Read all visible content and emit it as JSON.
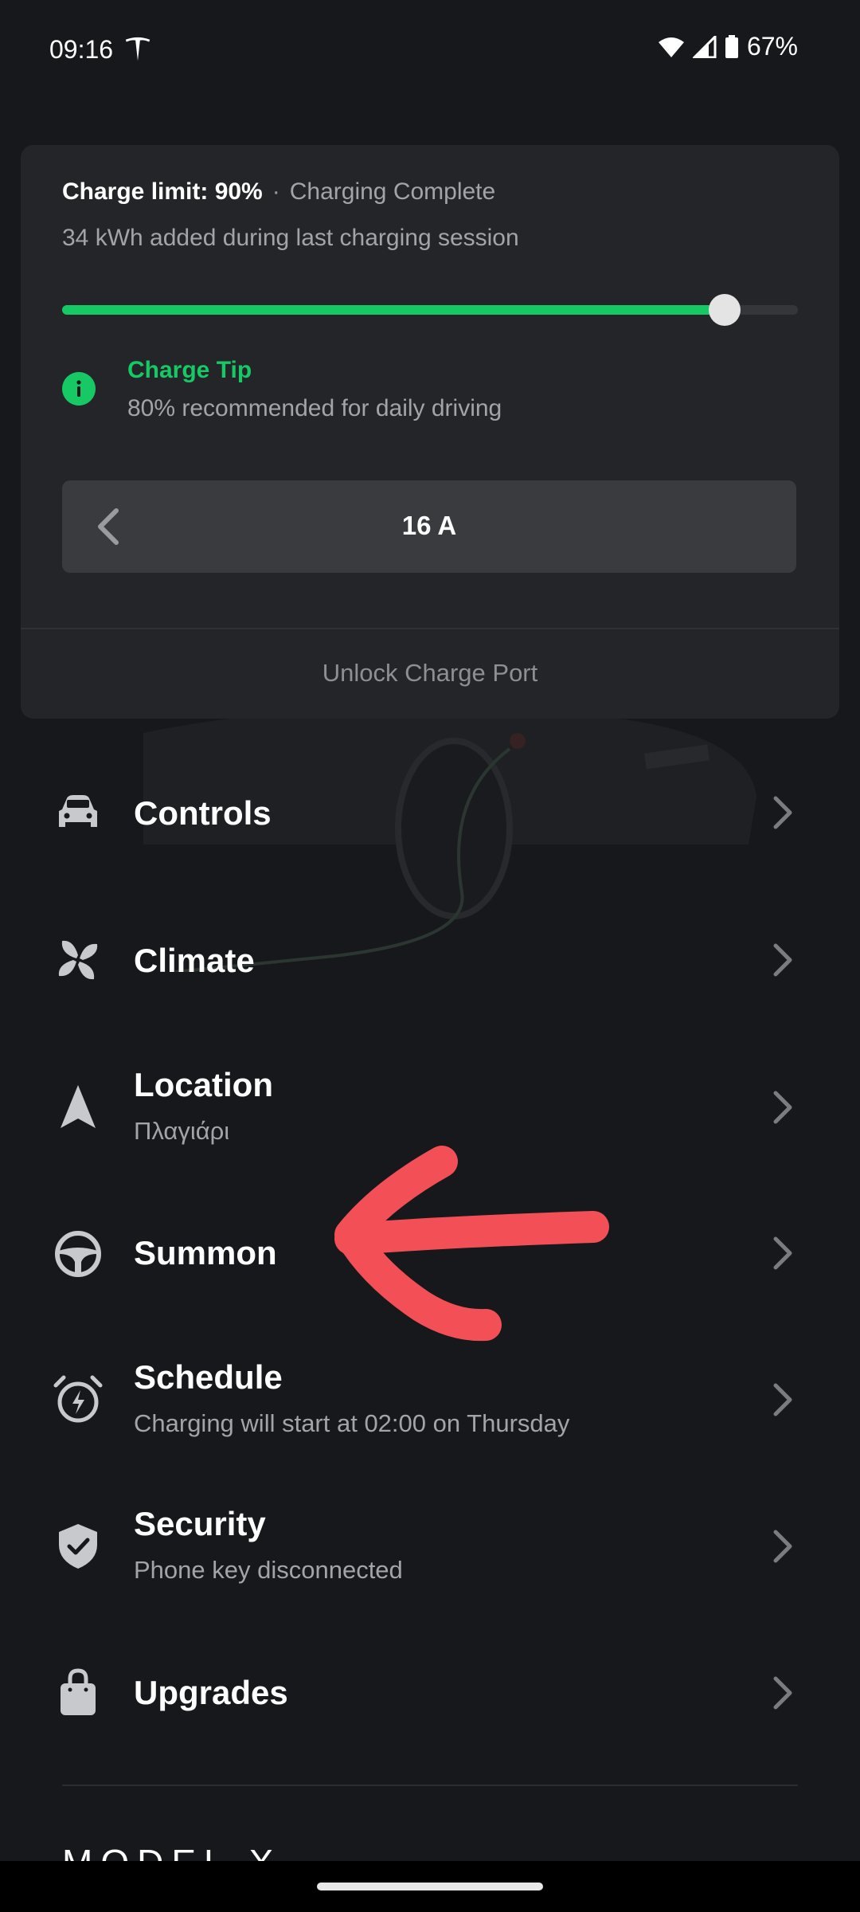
{
  "status_bar": {
    "time": "09:16",
    "battery_pct": "67%"
  },
  "charge_card": {
    "charge_limit": "Charge limit: 90%",
    "separator": "·",
    "status": "Charging Complete",
    "energy_added": "34 kWh added during last charging session",
    "slider_level": 0.9,
    "tip_title": "Charge Tip",
    "tip_text": "80% recommended for daily driving",
    "current": "16 A",
    "unlock_label": "Unlock Charge Port"
  },
  "menu": [
    {
      "key": "controls",
      "title": "Controls",
      "subtitle": "",
      "icon": "car-icon"
    },
    {
      "key": "climate",
      "title": "Climate",
      "subtitle": "",
      "icon": "fan-icon"
    },
    {
      "key": "location",
      "title": "Location",
      "subtitle": "Πλαγιάρι",
      "icon": "navigation-arrow-icon"
    },
    {
      "key": "summon",
      "title": "Summon",
      "subtitle": "",
      "icon": "steering-wheel-icon"
    },
    {
      "key": "schedule",
      "title": "Schedule",
      "subtitle": "Charging will start at 02:00 on Thursday",
      "icon": "alarm-clock-icon"
    },
    {
      "key": "security",
      "title": "Security",
      "subtitle": "Phone key disconnected",
      "icon": "shield-check-icon"
    },
    {
      "key": "upgrades",
      "title": "Upgrades",
      "subtitle": "",
      "icon": "shopping-bag-icon"
    }
  ],
  "footer": {
    "logo": "MODEL X"
  },
  "colors": {
    "accent_green": "#16c964",
    "background": "#17181b",
    "card": "#242528",
    "annotation_red": "#f25056"
  }
}
